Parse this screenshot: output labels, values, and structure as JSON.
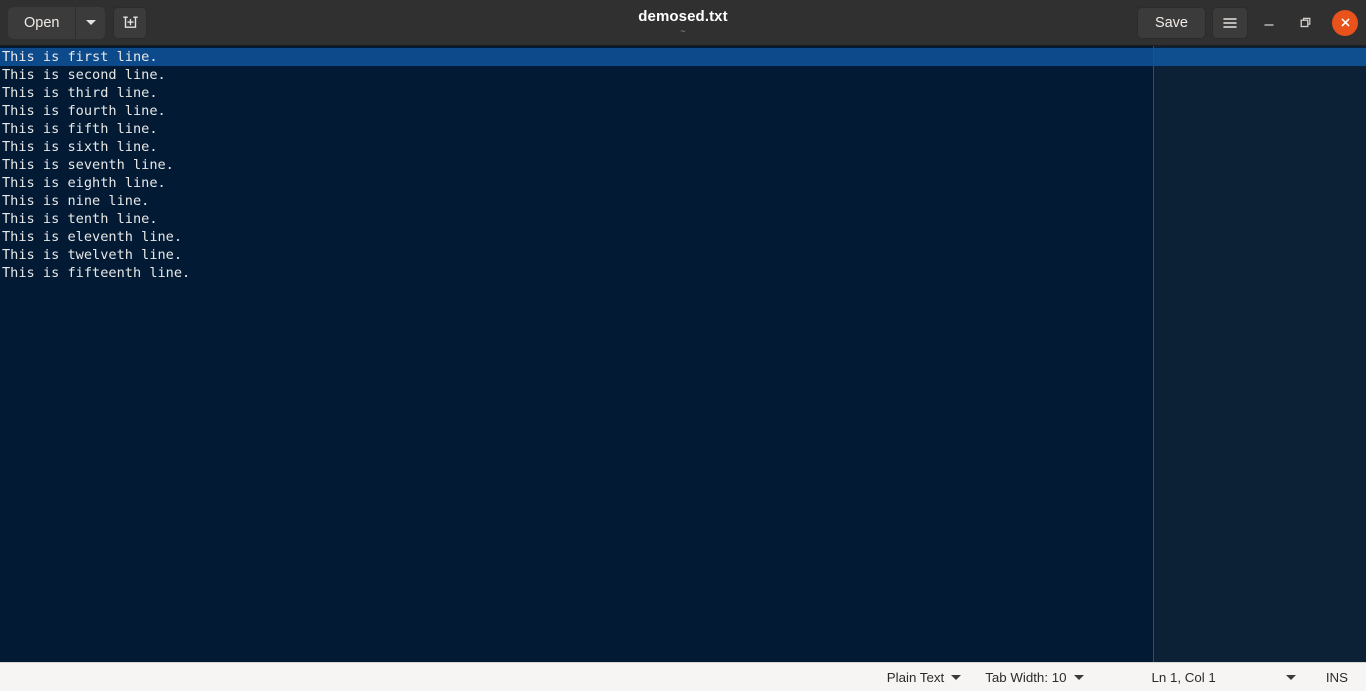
{
  "window": {
    "title": "demosed.txt",
    "subtitle": "~"
  },
  "toolbar": {
    "open_label": "Open",
    "open_dropdown_icon": "chevron-down-icon",
    "new_document_icon": "new-document-icon",
    "save_label": "Save",
    "menu_icon": "hamburger-menu-icon",
    "minimize_icon": "minimize-icon",
    "maximize_icon": "maximize-restore-icon",
    "close_icon": "close-icon",
    "close_color": "#e9521a"
  },
  "editor": {
    "background_color": "#021a33",
    "current_line_color": "#0d4a8c",
    "text_color": "#e8e8e8",
    "lines": [
      "This is first line.",
      "This is second line.",
      "This is third line.",
      "This is fourth line.",
      "This is fifth line.",
      "This is sixth line.",
      "This is seventh line.",
      "This is eighth line.",
      "This is nine line.",
      "This is tenth line.",
      "This is eleventh line.",
      "This is twelveth line.",
      "This is fifteenth line."
    ],
    "current_line_index": 0
  },
  "statusbar": {
    "language_label": "Plain Text",
    "tab_width_label": "Tab Width: 10",
    "position_label": "Ln 1, Col 1",
    "insert_mode_label": "INS",
    "language_dropdown_icon": "chevron-down-icon",
    "tab_width_dropdown_icon": "chevron-down-icon",
    "position_dropdown_icon": "chevron-down-icon"
  }
}
